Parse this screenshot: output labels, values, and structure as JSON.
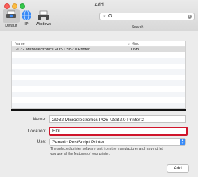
{
  "window": {
    "title": "Add"
  },
  "toolbar": {
    "default_label": "Default",
    "ip_label": "IP",
    "windows_label": "Windows",
    "search_value": "G",
    "search_label": "Search"
  },
  "list": {
    "columns": {
      "name": "Name",
      "kind": "Kind"
    },
    "rows": [
      {
        "name": "GD32 Microelectronics POS USB2.0 Printer",
        "kind": "USB"
      }
    ]
  },
  "detail": {
    "name_label": "Name:",
    "name_value": "GD32 Microelectronics POS USB2.0 Printer 2",
    "location_label": "Location:",
    "location_value": "EDI",
    "use_label": "Use:",
    "use_value": "Generic PostScript Printer",
    "note_line1": "The selected printer software isn't from the manufacturer and may not let",
    "note_line2": "you use all the features of your printer."
  },
  "footer": {
    "add_label": "Add"
  },
  "colors": {
    "highlight": "#d0152b",
    "accent": "#3a8bf7"
  }
}
